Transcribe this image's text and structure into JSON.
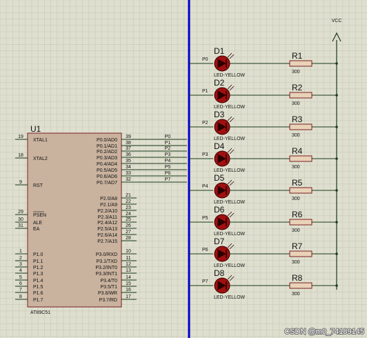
{
  "chip": {
    "ref": "U1",
    "part": "AT89C51",
    "left_pins": [
      {
        "num": "19",
        "name": "XTAL1"
      },
      {
        "num": "18",
        "name": "XTAL2"
      },
      {
        "num": "9",
        "name": "RST"
      },
      {
        "num": "29",
        "name": "PSEN"
      },
      {
        "num": "30",
        "name": "ALE"
      },
      {
        "num": "31",
        "name": "EA"
      },
      {
        "num": "1",
        "name": "P1.0"
      },
      {
        "num": "2",
        "name": "P1.1"
      },
      {
        "num": "3",
        "name": "P1.2"
      },
      {
        "num": "4",
        "name": "P1.3"
      },
      {
        "num": "5",
        "name": "P1.4"
      },
      {
        "num": "6",
        "name": "P1.5"
      },
      {
        "num": "7",
        "name": "P1.6"
      },
      {
        "num": "8",
        "name": "P1.7"
      }
    ],
    "right_pins": [
      {
        "num": "39",
        "name": "P0.0/AD0",
        "net": "P0"
      },
      {
        "num": "38",
        "name": "P0.1/AD1",
        "net": "P1"
      },
      {
        "num": "37",
        "name": "P0.2/AD2",
        "net": "P2"
      },
      {
        "num": "36",
        "name": "P0.3/AD3",
        "net": "P3"
      },
      {
        "num": "35",
        "name": "P0.4/AD4",
        "net": "P4"
      },
      {
        "num": "34",
        "name": "P0.5/AD5",
        "net": "P5"
      },
      {
        "num": "33",
        "name": "P0.6/AD6",
        "net": "P6"
      },
      {
        "num": "32",
        "name": "P0.7/AD7",
        "net": "P7"
      },
      {
        "num": "21",
        "name": "P2.0/A8"
      },
      {
        "num": "22",
        "name": "P2.1/A9"
      },
      {
        "num": "23",
        "name": "P2.2/A10"
      },
      {
        "num": "24",
        "name": "P2.3/A11"
      },
      {
        "num": "25",
        "name": "P2.4/A12"
      },
      {
        "num": "26",
        "name": "P2.5/A13"
      },
      {
        "num": "27",
        "name": "P2.6/A14"
      },
      {
        "num": "28",
        "name": "P2.7/A15"
      },
      {
        "num": "10",
        "name": "P3.0/RXD"
      },
      {
        "num": "11",
        "name": "P3.1/TXD"
      },
      {
        "num": "12",
        "name": "P3.2/INT0"
      },
      {
        "num": "13",
        "name": "P3.3/INT1"
      },
      {
        "num": "14",
        "name": "P3.4/T0"
      },
      {
        "num": "15",
        "name": "P3.5/T1"
      },
      {
        "num": "16",
        "name": "P3.6/WR"
      },
      {
        "num": "17",
        "name": "P3.7/RD"
      }
    ]
  },
  "leds": [
    {
      "ref": "D1",
      "type": "LED-YELLOW",
      "net": "P0"
    },
    {
      "ref": "D2",
      "type": "LED-YELLOW",
      "net": "P1"
    },
    {
      "ref": "D3",
      "type": "LED-YELLOW",
      "net": "P2"
    },
    {
      "ref": "D4",
      "type": "LED-YELLOW",
      "net": "P3"
    },
    {
      "ref": "D5",
      "type": "LED-YELLOW",
      "net": "P4"
    },
    {
      "ref": "D6",
      "type": "LED-YELLOW",
      "net": "P5"
    },
    {
      "ref": "D7",
      "type": "LED-YELLOW",
      "net": "P6"
    },
    {
      "ref": "D8",
      "type": "LED-YELLOW",
      "net": "P7"
    }
  ],
  "resistors": [
    {
      "ref": "R1",
      "value": "300"
    },
    {
      "ref": "R2",
      "value": "300"
    },
    {
      "ref": "R3",
      "value": "300"
    },
    {
      "ref": "R4",
      "value": "300"
    },
    {
      "ref": "R5",
      "value": "300"
    },
    {
      "ref": "R6",
      "value": "300"
    },
    {
      "ref": "R7",
      "value": "300"
    },
    {
      "ref": "R8",
      "value": "300"
    }
  ],
  "power": {
    "label": "VCC"
  },
  "watermark": "CSDN @m0_74189145",
  "colors": {
    "background": "#dfdfcf",
    "grid": "#c9c9b8",
    "chip_fill": "#c9b29e",
    "chip_border": "#7a1f1f",
    "wire": "#1a3a1a",
    "bus": "#0000cc",
    "led_body": "#a01010",
    "resistor_fill": "#e8d2b8",
    "resistor_border": "#7a1f1f"
  }
}
